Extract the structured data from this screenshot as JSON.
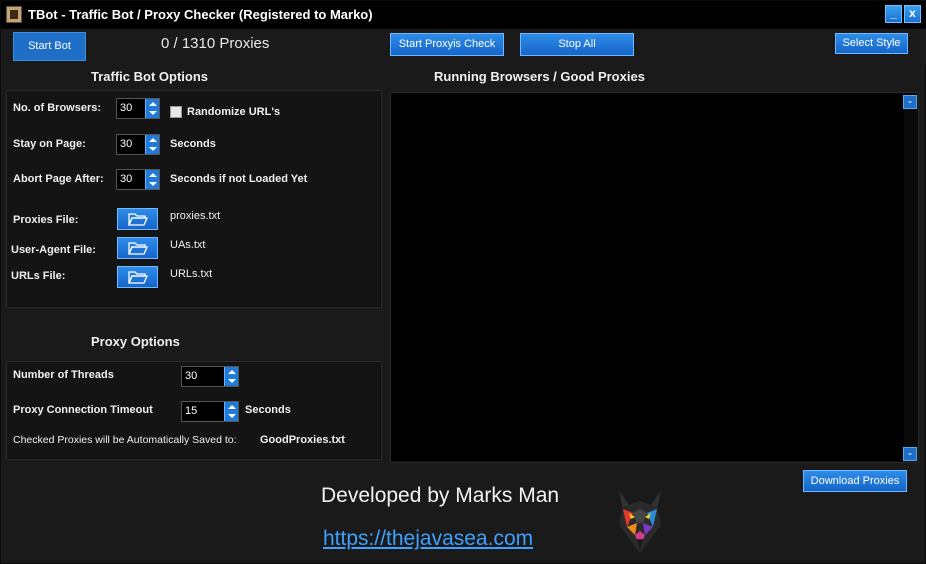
{
  "window": {
    "title": "TBot - Traffic Bot / Proxy Checker (Registered to Marko)",
    "minimize_glyph": "_",
    "close_glyph": "x"
  },
  "toolbar": {
    "start_bot": "Start Bot",
    "counter": "0 / 1310  Proxies",
    "start_proxy_check": "Start Proxyis Check",
    "stop_all": "Stop All",
    "select_style": "Select Style"
  },
  "traffic_bot": {
    "heading": "Traffic Bot Options",
    "browsers_label": "No. of Browsers:",
    "browsers_value": "30",
    "randomize_label": "Randomize URL's",
    "randomize_checked": false,
    "stay_label": "Stay on Page:",
    "stay_value": "30",
    "stay_unit": "Seconds",
    "abort_label": "Abort Page After:",
    "abort_value": "30",
    "abort_unit": "Seconds if not Loaded Yet",
    "proxies_file_label": "Proxies File:",
    "proxies_file_value": "proxies.txt",
    "ua_file_label": "User-Agent  File:",
    "ua_file_value": "UAs.txt",
    "urls_file_label": "URLs  File:",
    "urls_file_value": "URLs.txt"
  },
  "proxy_options": {
    "heading": "Proxy  Options",
    "threads_label": "Number of Threads",
    "threads_value": "30",
    "timeout_label": "Proxy Connection Timeout",
    "timeout_value": "15",
    "timeout_unit": "Seconds",
    "saved_note": "Checked Proxies will be Automatically Saved to:",
    "saved_file": "GoodProxies.txt"
  },
  "browsers_panel": {
    "heading": "Running Browsers / Good Proxies"
  },
  "footer": {
    "download_proxies": "Download Proxies",
    "developer": "Developed by Marks Man",
    "url": "https://thejavasea.com"
  },
  "colors": {
    "accent_blue": "#1f7ad8",
    "link_blue": "#3ea0ff",
    "background": "#1a1a1a"
  },
  "icons": [
    "app-icon",
    "minimize-icon",
    "close-icon",
    "folder-open-icon",
    "wolf-logo"
  ]
}
